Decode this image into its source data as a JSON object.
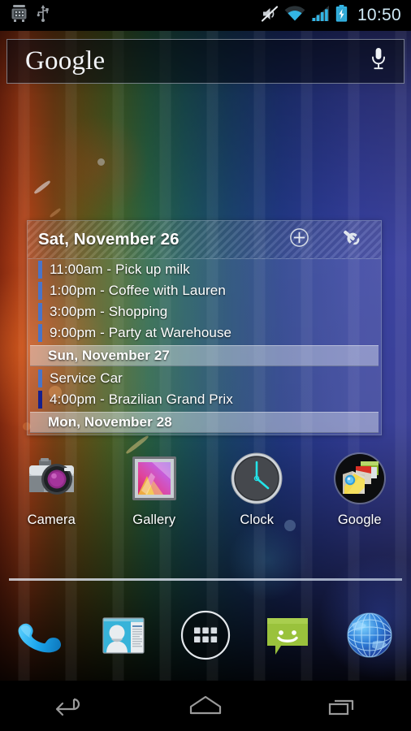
{
  "statusbar": {
    "icons_left": [
      {
        "name": "android-debug-icon",
        "label": "Android"
      },
      {
        "name": "usb-icon",
        "label": "USB"
      }
    ],
    "icons_right": [
      {
        "name": "mute-icon",
        "label": "Silent"
      },
      {
        "name": "wifi-icon",
        "label": "Wi-Fi"
      },
      {
        "name": "cellular-signal-icon",
        "label": "Signal"
      },
      {
        "name": "battery-charging-icon",
        "label": "Charging"
      }
    ],
    "clock": "10:50",
    "clock_color": "#cfe9f5"
  },
  "search": {
    "brand": "Google",
    "mic_icon": "microphone-icon"
  },
  "calendar": {
    "title": "Sat, November 26",
    "add_icon": "plus-circle-icon",
    "settings_icon": "wrench-icon",
    "colors": {
      "event_blue": "#4a74c8",
      "event_navy": "#16208c",
      "dayhead_bg": "#e8edf5"
    },
    "rows": [
      {
        "type": "event",
        "text": "11:00am - Pick up milk",
        "bar": "#4a74c8"
      },
      {
        "type": "event",
        "text": "1:00pm - Coffee with Lauren",
        "bar": "#4a74c8"
      },
      {
        "type": "event",
        "text": "3:00pm - Shopping",
        "bar": "#4a74c8"
      },
      {
        "type": "event",
        "text": "9:00pm - Party at Warehouse",
        "bar": "#4a74c8"
      },
      {
        "type": "day",
        "text": "Sun, November 27",
        "bar": ""
      },
      {
        "type": "event",
        "text": "Service Car",
        "bar": "#4a74c8"
      },
      {
        "type": "event",
        "text": "4:00pm - Brazilian Grand Prix",
        "bar": "#16208c"
      },
      {
        "type": "day",
        "text": "Mon, November 28",
        "bar": ""
      }
    ]
  },
  "apps": [
    {
      "label": "Camera",
      "icon": "camera-icon"
    },
    {
      "label": "Gallery",
      "icon": "gallery-icon"
    },
    {
      "label": "Clock",
      "icon": "clock-icon"
    },
    {
      "label": "Google",
      "icon": "google-folder-icon"
    }
  ],
  "dock": [
    {
      "name": "phone-icon",
      "label": "Phone"
    },
    {
      "name": "people-icon",
      "label": "People"
    },
    {
      "name": "app-drawer-icon",
      "label": "Apps"
    },
    {
      "name": "messaging-icon",
      "label": "Messaging"
    },
    {
      "name": "browser-icon",
      "label": "Browser"
    }
  ],
  "navbar": [
    {
      "name": "back-icon",
      "label": "Back"
    },
    {
      "name": "home-icon",
      "label": "Home"
    },
    {
      "name": "recents-icon",
      "label": "Recents"
    }
  ]
}
